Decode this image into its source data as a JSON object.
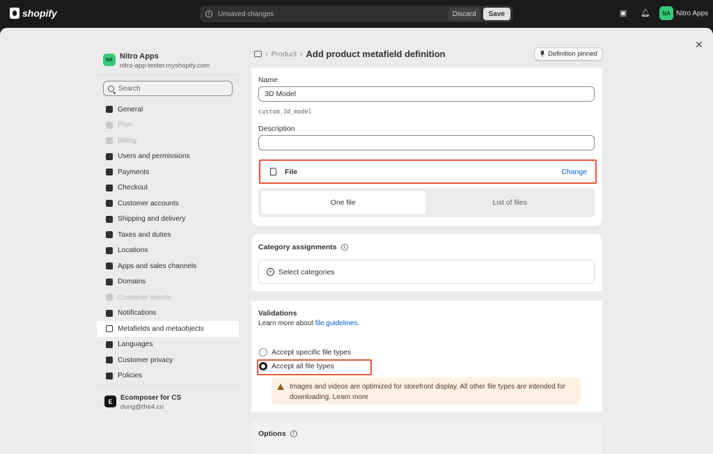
{
  "topbar": {
    "logo": "shopify",
    "unsaved": "Unsaved changes",
    "discard": "Discard",
    "save": "Save",
    "store_initials": "NA",
    "store_name": "Nitro Apps"
  },
  "sidebar": {
    "store_initials": "NA",
    "store_name": "Nitro Apps",
    "store_url": "nitro-app-tester.myshopify.com",
    "search_placeholder": "Search",
    "items": [
      {
        "label": "General"
      },
      {
        "label": "Plan"
      },
      {
        "label": "Billing"
      },
      {
        "label": "Users and permissions"
      },
      {
        "label": "Payments"
      },
      {
        "label": "Checkout"
      },
      {
        "label": "Customer accounts"
      },
      {
        "label": "Shipping and delivery"
      },
      {
        "label": "Taxes and duties"
      },
      {
        "label": "Locations"
      },
      {
        "label": "Apps and sales channels"
      },
      {
        "label": "Domains"
      },
      {
        "label": "Customer events"
      },
      {
        "label": "Notifications"
      },
      {
        "label": "Metafields and metaobjects"
      },
      {
        "label": "Languages"
      },
      {
        "label": "Customer privacy"
      },
      {
        "label": "Policies"
      }
    ],
    "app_logo": "E",
    "app_name": "Ecomposer for CS",
    "app_email": "dung@the4.co"
  },
  "header": {
    "crumb": "Product",
    "title": "Add product metafield definition",
    "pinned": "Definition pinned"
  },
  "definition": {
    "name_label": "Name",
    "name_value": "3D Model",
    "namespace_key": "custom.3d_model",
    "description_label": "Description",
    "description_value": "",
    "type": "File",
    "change": "Change",
    "seg_one": "One file",
    "seg_list": "List of files"
  },
  "category": {
    "title": "Category assignments",
    "select": "Select categories"
  },
  "validations": {
    "title": "Validations",
    "learn_prefix": "Learn more about ",
    "learn_link": "file guidelines",
    "learn_suffix": ".",
    "opt_specific": "Accept specific file types",
    "opt_all": "Accept all file types",
    "notice_text": "Images and videos are optimized for storefront display. All other file types are intended for downloading. ",
    "notice_link": "Learn more"
  },
  "options": {
    "title": "Options"
  }
}
